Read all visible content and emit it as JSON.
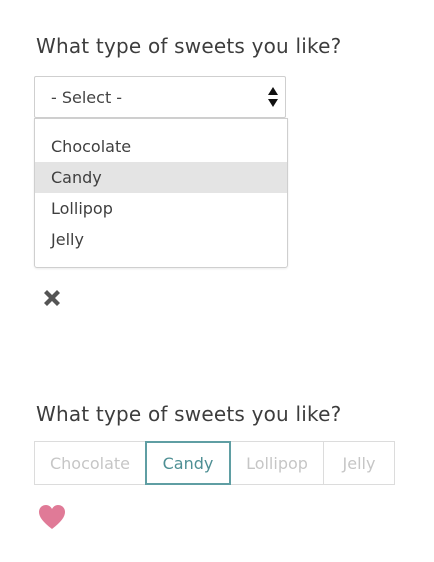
{
  "section1": {
    "question": "What type of sweets you like?",
    "select": {
      "value": "- Select -",
      "options": [
        {
          "label": "Chocolate",
          "highlighted": false
        },
        {
          "label": "Candy",
          "highlighted": true
        },
        {
          "label": "Lollipop",
          "highlighted": false
        },
        {
          "label": "Jelly",
          "highlighted": false
        }
      ]
    },
    "feedback_icon": "close-icon"
  },
  "section2": {
    "question": "What type of sweets you like?",
    "options": [
      {
        "label": "Chocolate",
        "selected": false
      },
      {
        "label": "Candy",
        "selected": true
      },
      {
        "label": "Lollipop",
        "selected": false
      },
      {
        "label": "Jelly",
        "selected": false
      }
    ],
    "feedback_icon": "heart-icon"
  },
  "colors": {
    "selected_border": "#5f9ea3",
    "highlight_bg": "#e4e4e4",
    "heart": "#e07a97",
    "close": "#555555"
  }
}
